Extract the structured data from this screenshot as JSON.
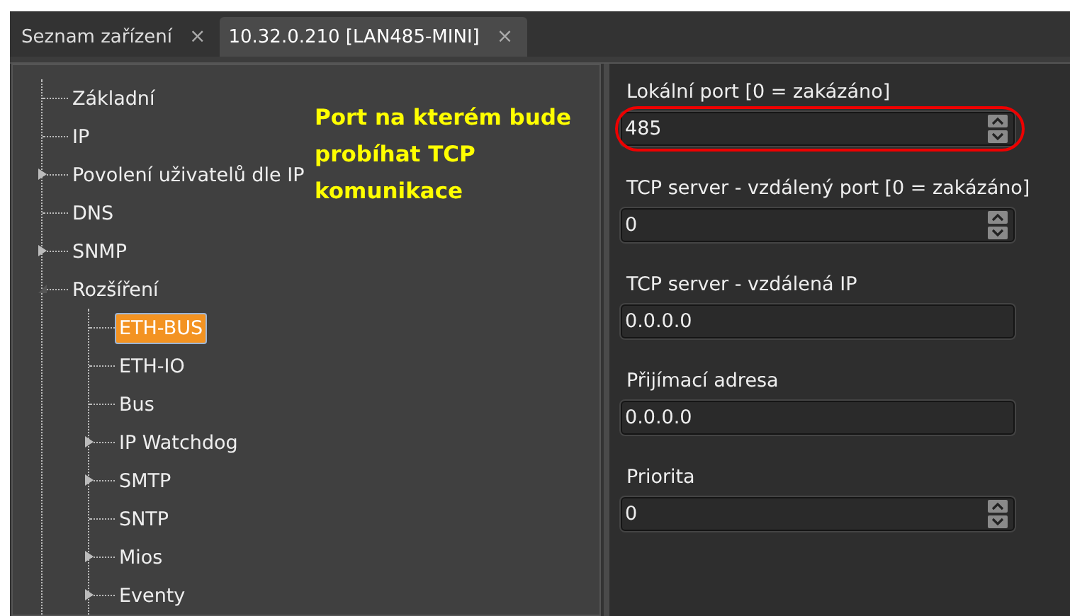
{
  "tabs": [
    {
      "label": "Seznam zařízení",
      "close": "×",
      "selected": false
    },
    {
      "label": "10.32.0.210 [LAN485-MINI]",
      "close": "×",
      "selected": true
    }
  ],
  "tree": [
    {
      "label": "Základní",
      "kind": "leaf",
      "selected": false
    },
    {
      "label": "IP",
      "kind": "leaf",
      "selected": false
    },
    {
      "label": "Povolení uživatelů dle IP",
      "kind": "folder",
      "expanded": false,
      "selected": false
    },
    {
      "label": "DNS",
      "kind": "leaf",
      "selected": false
    },
    {
      "label": "SNMP",
      "kind": "folder",
      "expanded": false,
      "selected": false
    },
    {
      "label": "Rozšíření",
      "kind": "folder",
      "expanded": true,
      "selected": false,
      "children": [
        {
          "label": "ETH-BUS",
          "kind": "leaf",
          "selected": true
        },
        {
          "label": "ETH-IO",
          "kind": "leaf",
          "selected": false
        },
        {
          "label": "Bus",
          "kind": "leaf",
          "selected": false
        },
        {
          "label": "IP Watchdog",
          "kind": "folder",
          "expanded": false,
          "selected": false
        },
        {
          "label": "SMTP",
          "kind": "folder",
          "expanded": false,
          "selected": false
        },
        {
          "label": "SNTP",
          "kind": "leaf",
          "selected": false
        },
        {
          "label": "Mios",
          "kind": "folder",
          "expanded": false,
          "selected": false
        },
        {
          "label": "Eventy",
          "kind": "folder",
          "expanded": false,
          "selected": false
        }
      ]
    }
  ],
  "annotation": "Port na kterém bude probíhat TCP komunikace",
  "fields": [
    {
      "label": "Lokální port [0 = zakázáno]",
      "value": "485",
      "kind": "spin",
      "highlighted": true
    },
    {
      "label": "TCP server - vzdálený port [0 = zakázáno]",
      "value": "0",
      "kind": "spin",
      "highlighted": false
    },
    {
      "label": "TCP server - vzdálená IP",
      "value": "0.0.0.0",
      "kind": "text",
      "highlighted": false
    },
    {
      "label": "Přijímací adresa",
      "value": "0.0.0.0",
      "kind": "text",
      "highlighted": false
    },
    {
      "label": "Priorita",
      "value": "0",
      "kind": "spin",
      "highlighted": false
    }
  ]
}
